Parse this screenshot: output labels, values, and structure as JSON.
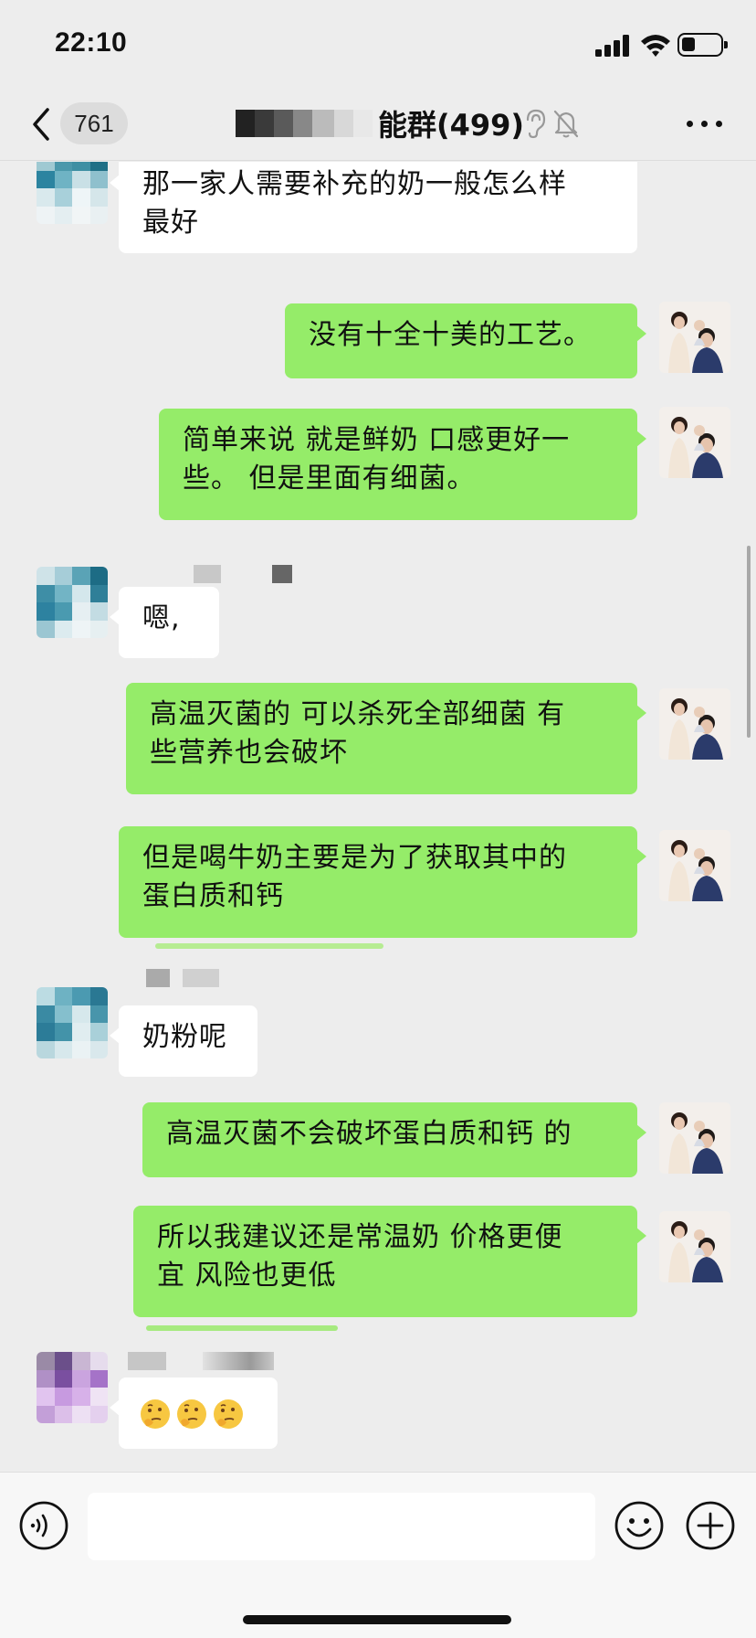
{
  "status_bar": {
    "time": "22:10",
    "battery_level": 0.3
  },
  "nav": {
    "back_count": "761",
    "title": "能群(499)"
  },
  "messages": [
    {
      "side": "in",
      "text": "那一家人需要补充的奶一般怎么样\n最好",
      "avatar": "teal"
    },
    {
      "side": "out",
      "text": "没有十全十美的工艺。"
    },
    {
      "side": "out",
      "text": "简单来说 就是鲜奶  口感更好一\n些。 但是里面有细菌。"
    },
    {
      "side": "in",
      "text": "嗯,",
      "avatar": "teal"
    },
    {
      "side": "out",
      "text": "高温灭菌的 可以杀死全部细菌  有\n些营养也会破坏"
    },
    {
      "side": "out",
      "text": "但是喝牛奶主要是为了获取其中的\n蛋白质和钙"
    },
    {
      "side": "in",
      "text": "奶粉呢",
      "avatar": "teal"
    },
    {
      "side": "out",
      "text": "高温灭菌不会破坏蛋白质和钙 的"
    },
    {
      "side": "out",
      "text": "所以我建议还是常温奶  价格更便\n宜  风险也更低"
    },
    {
      "side": "in",
      "text": "",
      "emoji": [
        "thinking-face-icon",
        "thinking-face-icon",
        "thinking-face-icon"
      ],
      "avatar": "purple"
    }
  ],
  "input": {
    "value": "",
    "placeholder": ""
  },
  "colors": {
    "background": "#ededed",
    "outgoing_bubble": "#95ec69",
    "incoming_bubble": "#ffffff",
    "input_bar": "#f7f7f7"
  },
  "icons": [
    "back-icon",
    "ear-icon",
    "mute-bell-icon",
    "more-icon",
    "voice-icon",
    "emoji-icon",
    "add-icon"
  ]
}
